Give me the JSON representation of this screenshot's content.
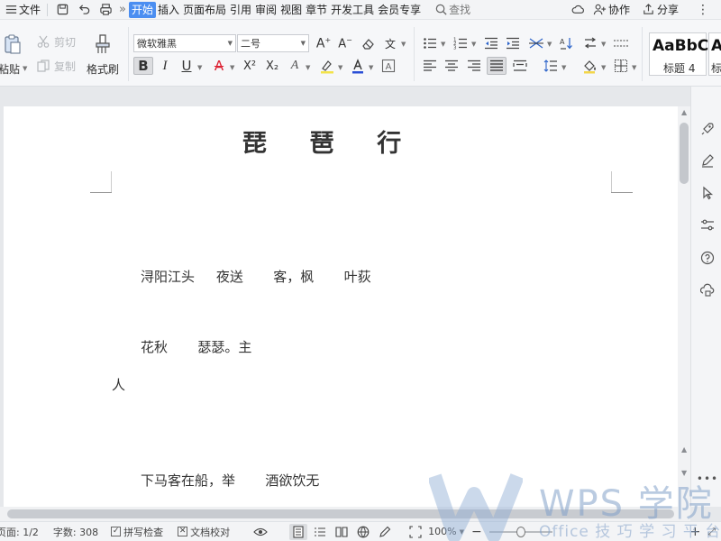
{
  "menubar": {
    "file_label": "文件",
    "tabs": [
      "开始",
      "插入",
      "页面布局",
      "引用",
      "审阅",
      "视图",
      "章节",
      "开发工具",
      "会员专享"
    ],
    "active_tab": "开始",
    "search_label": "查找",
    "collab_label": "协作",
    "share_label": "分享",
    "more_symbol": "»"
  },
  "ribbon": {
    "paste_label": "粘贴",
    "cut_label": "剪切",
    "copy_label": "复制",
    "format_painter_label": "格式刷",
    "font_name": "微软雅黑",
    "font_size": "二号",
    "bold_glyph": "B",
    "italic_glyph": "I",
    "underline_glyph": "U",
    "strike_glyph": "A",
    "superscript_glyph": "X²",
    "subscript_glyph": "X₂",
    "style_preview": "AaBbC",
    "style_name": "标题 4",
    "style_name_partial": "标"
  },
  "document": {
    "title": "琵    琶    行",
    "lines": [
      "浔阳江头     夜送       客，枫       叶荻",
      "花秋       瑟瑟。主",
      "人",
      "下马客在船，举       酒欲饮无"
    ]
  },
  "statusbar": {
    "page_info": "页面: 1/2",
    "word_count": "字数: 308",
    "spellcheck_label": "拼写检查",
    "proofread_label": "文档校对",
    "zoom_level": "100%",
    "zoom_minus": "−",
    "zoom_plus": "+"
  },
  "watermark": {
    "brand": "WPS 学院",
    "tagline": "Office 技 巧 学 习 平 台"
  },
  "colors": {
    "accent": "#4b8ef1",
    "page_bg": "#ffffff",
    "workspace_bg": "#e6e8eb"
  }
}
